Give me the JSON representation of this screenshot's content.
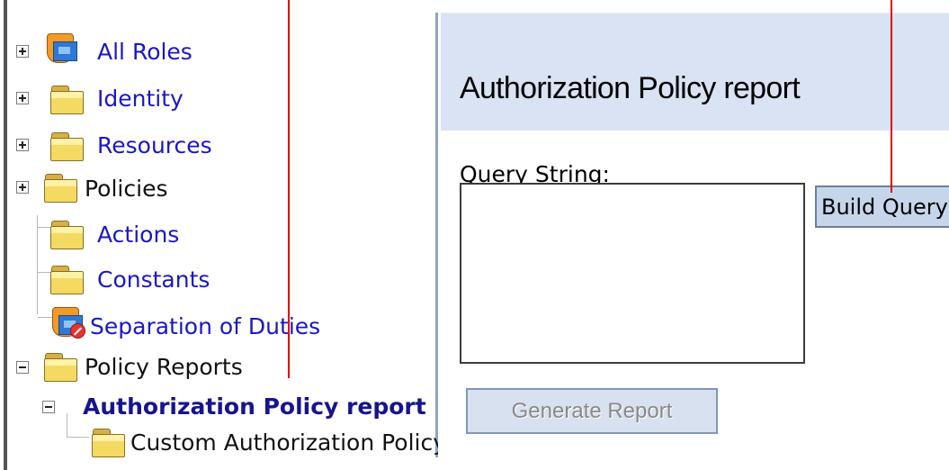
{
  "tree": {
    "items": [
      {
        "label": "All Roles",
        "icon": "roles-icon",
        "expander": "plus"
      },
      {
        "label": "Identity",
        "icon": "folder-icon",
        "expander": "plus"
      },
      {
        "label": "Resources",
        "icon": "folder-icon",
        "expander": "plus"
      },
      {
        "label": "Policies",
        "icon": "folder-icon",
        "expander": "plus"
      },
      {
        "label": "Actions",
        "icon": "folder-icon"
      },
      {
        "label": "Constants",
        "icon": "folder-icon"
      },
      {
        "label": "Separation of Duties",
        "icon": "separation-icon"
      },
      {
        "label": "Policy Reports",
        "icon": "folder-icon",
        "expander": "minus"
      },
      {
        "label": "Authorization Policy report",
        "expander": "minus",
        "selected": true
      },
      {
        "label": "Custom Authorization Policy",
        "icon": "folder-icon"
      }
    ]
  },
  "main": {
    "title": "Authorization Policy report",
    "query": {
      "label": "Query String:",
      "value": ""
    },
    "buttons": {
      "build_query": "Build Query",
      "generate_report": "Generate Report"
    }
  },
  "colors": {
    "link": "#1917c9",
    "selected_text": "#16148e",
    "header_background": "#d9e3f3",
    "button_background": "#c6d5ea",
    "annotation_line": "#e00000"
  }
}
